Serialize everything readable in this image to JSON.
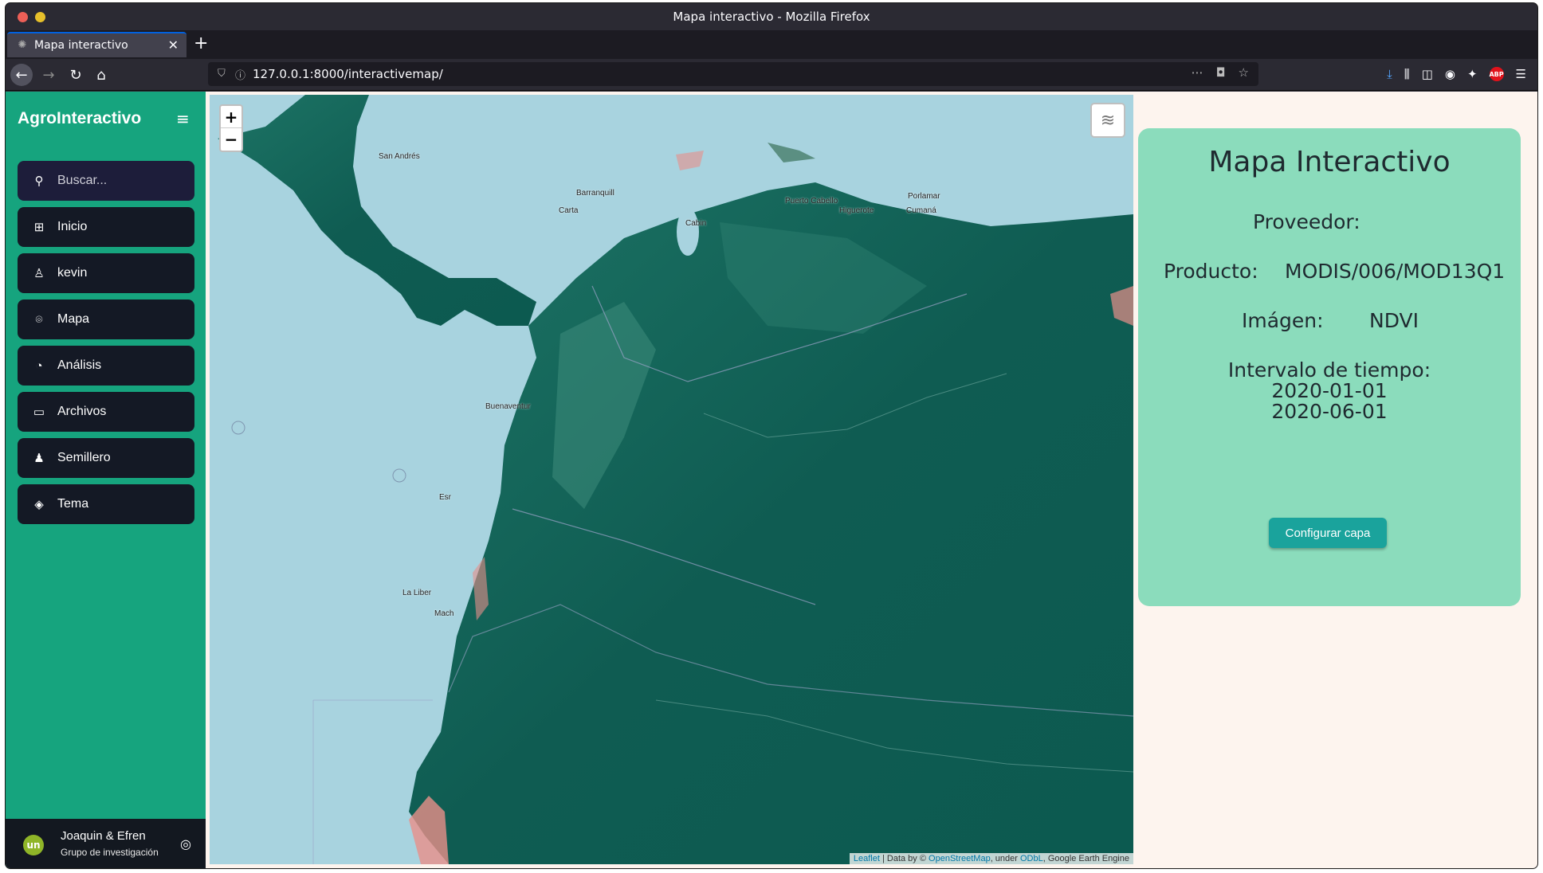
{
  "window": {
    "title": "Mapa interactivo - Mozilla Firefox"
  },
  "tab": {
    "label": "Mapa interactivo"
  },
  "urlbar": {
    "url": "127.0.0.1:8000/interactivemap/"
  },
  "sidebar": {
    "brand": "AgroInteractivo",
    "search_placeholder": "Buscar...",
    "items": [
      {
        "label": "Inicio",
        "icon": "grid-icon"
      },
      {
        "label": "kevin",
        "icon": "user-icon"
      },
      {
        "label": "Mapa",
        "icon": "map-pin-icon"
      },
      {
        "label": "Análisis",
        "icon": "pie-chart-icon"
      },
      {
        "label": "Archivos",
        "icon": "folder-icon"
      },
      {
        "label": "Semillero",
        "icon": "group-icon"
      },
      {
        "label": "Tema",
        "icon": "paint-bucket-icon"
      }
    ],
    "profile": {
      "avatar": "un",
      "name": "Joaquin & Efren",
      "role": "Grupo de investigación"
    }
  },
  "map": {
    "labels": [
      "San Andrés",
      "Barranquill",
      "Carta",
      "Cabin",
      "Puerto Cabello",
      "Higuerote",
      "Porlamar",
      "Cumaná",
      "Buenaventur",
      "La Liber",
      "Mach",
      "Esr"
    ],
    "attribution": {
      "leaflet": "Leaflet",
      "data_by": " | Data by © ",
      "osm": "OpenStreetMap",
      "under": ", under ",
      "odbl": "ODbL",
      "gee": ", Google Earth Engine"
    }
  },
  "panel": {
    "title": "Mapa Interactivo",
    "provider_label": "Proveedor:",
    "product_label": "Producto:",
    "product_value": "MODIS/006/MOD13Q1",
    "image_label": "Imágen:",
    "image_value": "NDVI",
    "interval_label": "Intervalo de tiempo:",
    "interval_start": "2020-01-01",
    "interval_end": "2020-06-01",
    "button": "Configurar capa"
  },
  "colors": {
    "sidebar": "#16a47e",
    "panel": "#8bdcbc",
    "button": "#1aa39c",
    "map_water": "#a8d3df",
    "map_land": "#0f5c52"
  }
}
